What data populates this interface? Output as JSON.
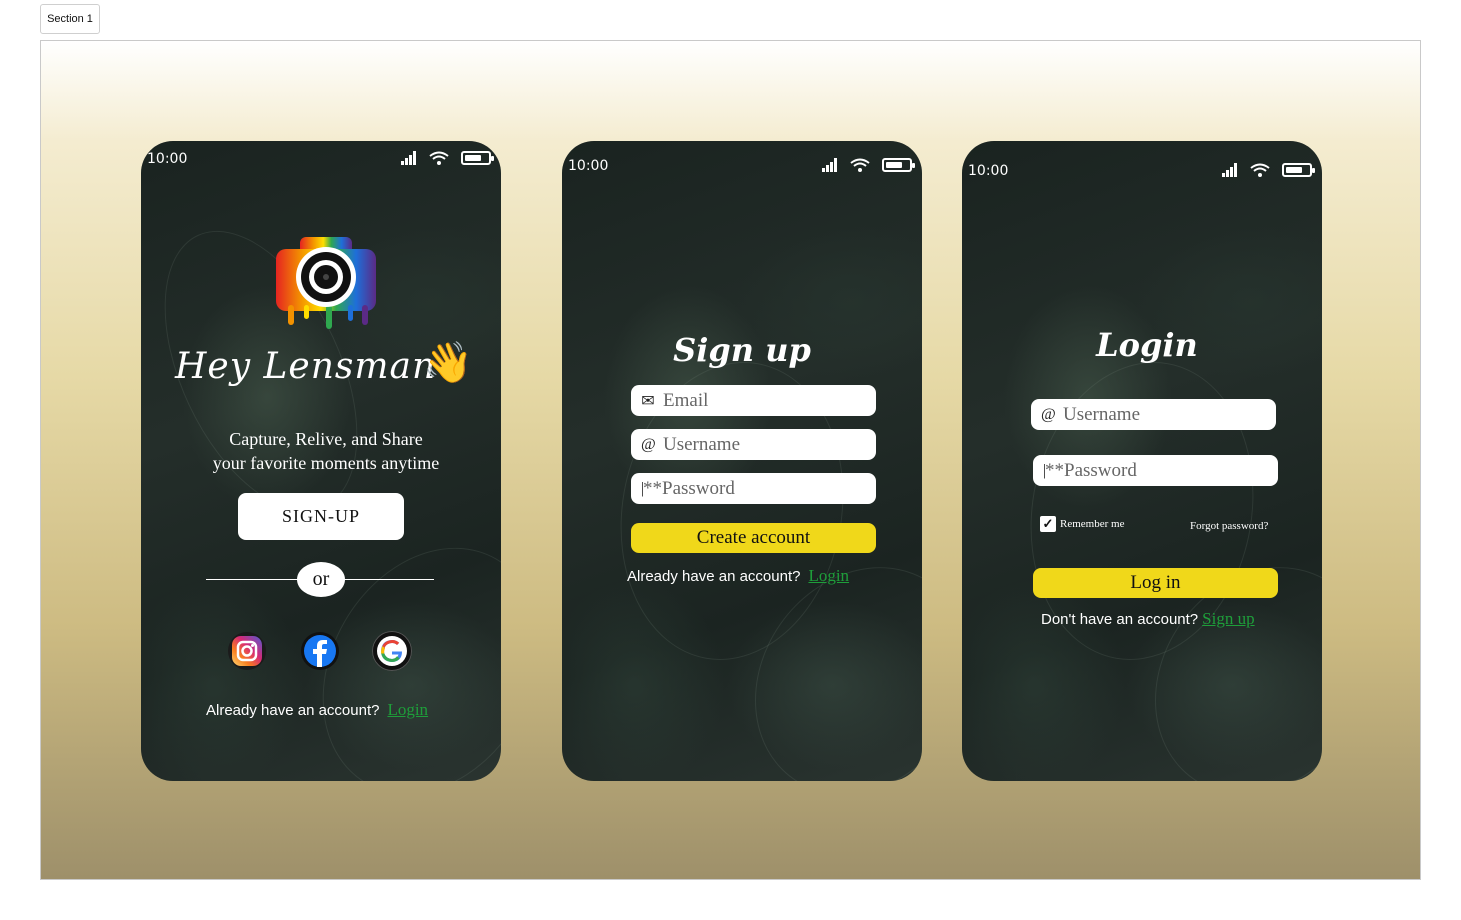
{
  "canvas": {
    "section_label": "Section 1"
  },
  "status_bar": {
    "time": "10:00",
    "network": "4G"
  },
  "welcome": {
    "greeting": "Hey Lensman",
    "wave_emoji": "👋",
    "tagline_line1": "Capture, Relive, and Share",
    "tagline_line2": "your favorite moments anytime",
    "signup_button": "SIGN-UP",
    "or_label": "or",
    "social_icons": [
      "instagram-icon",
      "facebook-icon",
      "google-icon"
    ],
    "account_prompt": "Already have an account?",
    "login_link": "Login"
  },
  "signup": {
    "title": "Sign up",
    "email_placeholder": "Email",
    "username_placeholder": "Username",
    "password_placeholder": "**Password",
    "create_button": "Create account",
    "account_prompt": "Already have an account?",
    "login_link": "Login"
  },
  "login": {
    "title": "Login",
    "username_placeholder": "Username",
    "password_placeholder": "**Password",
    "remember_label": "Remember me",
    "remember_checked": true,
    "forgot_link": "Forgot password?",
    "login_button": "Log in",
    "account_prompt": "Don't have an account?",
    "signup_link": "Sign up"
  },
  "colors": {
    "accent_yellow": "#f0d81a",
    "link_green": "#1e9e3a",
    "facebook_blue": "#1877f2"
  }
}
